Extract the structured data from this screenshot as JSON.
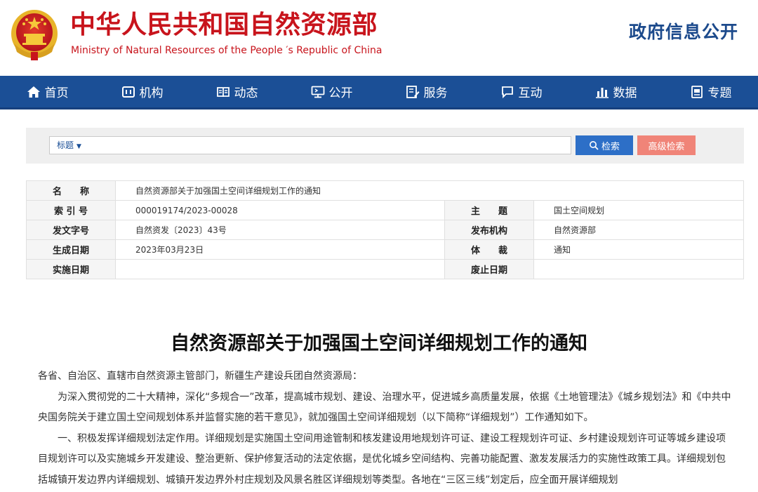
{
  "header": {
    "title_cn": "中华人民共和国自然资源部",
    "title_en": "Ministry of Natural Resources of the People ′s Republic of China",
    "gov_info": "政府信息公开"
  },
  "nav": {
    "items": [
      {
        "label": "首页",
        "icon": "home-icon"
      },
      {
        "label": "机构",
        "icon": "building-icon"
      },
      {
        "label": "动态",
        "icon": "book-icon"
      },
      {
        "label": "公开",
        "icon": "monitor-icon"
      },
      {
        "label": "服务",
        "icon": "edit-icon"
      },
      {
        "label": "互动",
        "icon": "chat-icon"
      },
      {
        "label": "数据",
        "icon": "bar-chart-icon"
      },
      {
        "label": "专题",
        "icon": "document-icon"
      }
    ]
  },
  "search": {
    "field_selector": "标题",
    "input_value": "",
    "search_label": "检索",
    "advanced_label": "高级检索"
  },
  "meta": {
    "name_label": "名　　称",
    "name_value": "自然资源部关于加强国土空间详细规划工作的通知",
    "index_label": "索 引 号",
    "index_value": "000019174/2023-00028",
    "topic_label": "主　　题",
    "topic_value": "国土空间规划",
    "doc_no_label": "发文字号",
    "doc_no_value": "自然资发〔2023〕43号",
    "issuer_label": "发布机构",
    "issuer_value": "自然资源部",
    "date_label": "生成日期",
    "date_value": "2023年03月23日",
    "genre_label": "体　　裁",
    "genre_value": "通知",
    "effective_label": "实施日期",
    "effective_value": "",
    "repeal_label": "废止日期",
    "repeal_value": ""
  },
  "article": {
    "title": "自然资源部关于加强国土空间详细规划工作的通知",
    "salutation": "各省、自治区、直辖市自然资源主管部门，新疆生产建设兵团自然资源局：",
    "para1": "为深入贯彻党的二十大精神，深化“多规合一”改革，提高城市规划、建设、治理水平，促进城乡高质量发展，依据《土地管理法》《城乡规划法》和《中共中央国务院关于建立国土空间规划体系并监督实施的若干意见》，就加强国土空间详细规划（以下简称“详细规划”）工作通知如下。",
    "para2": "一、积极发挥详细规划法定作用。详细规划是实施国土空间用途管制和核发建设用地规划许可证、建设工程规划许可证、乡村建设规划许可证等城乡建设项目规划许可以及实施城乡开发建设、整治更新、保护修复活动的法定依据，是优化城乡空间结构、完善功能配置、激发发展活力的实施性政策工具。详细规划包括城镇开发边界内详细规划、城镇开发边界外村庄规划及风景名胜区详细规划等类型。各地在“三区三线”划定后，应全面开展详细规划"
  }
}
